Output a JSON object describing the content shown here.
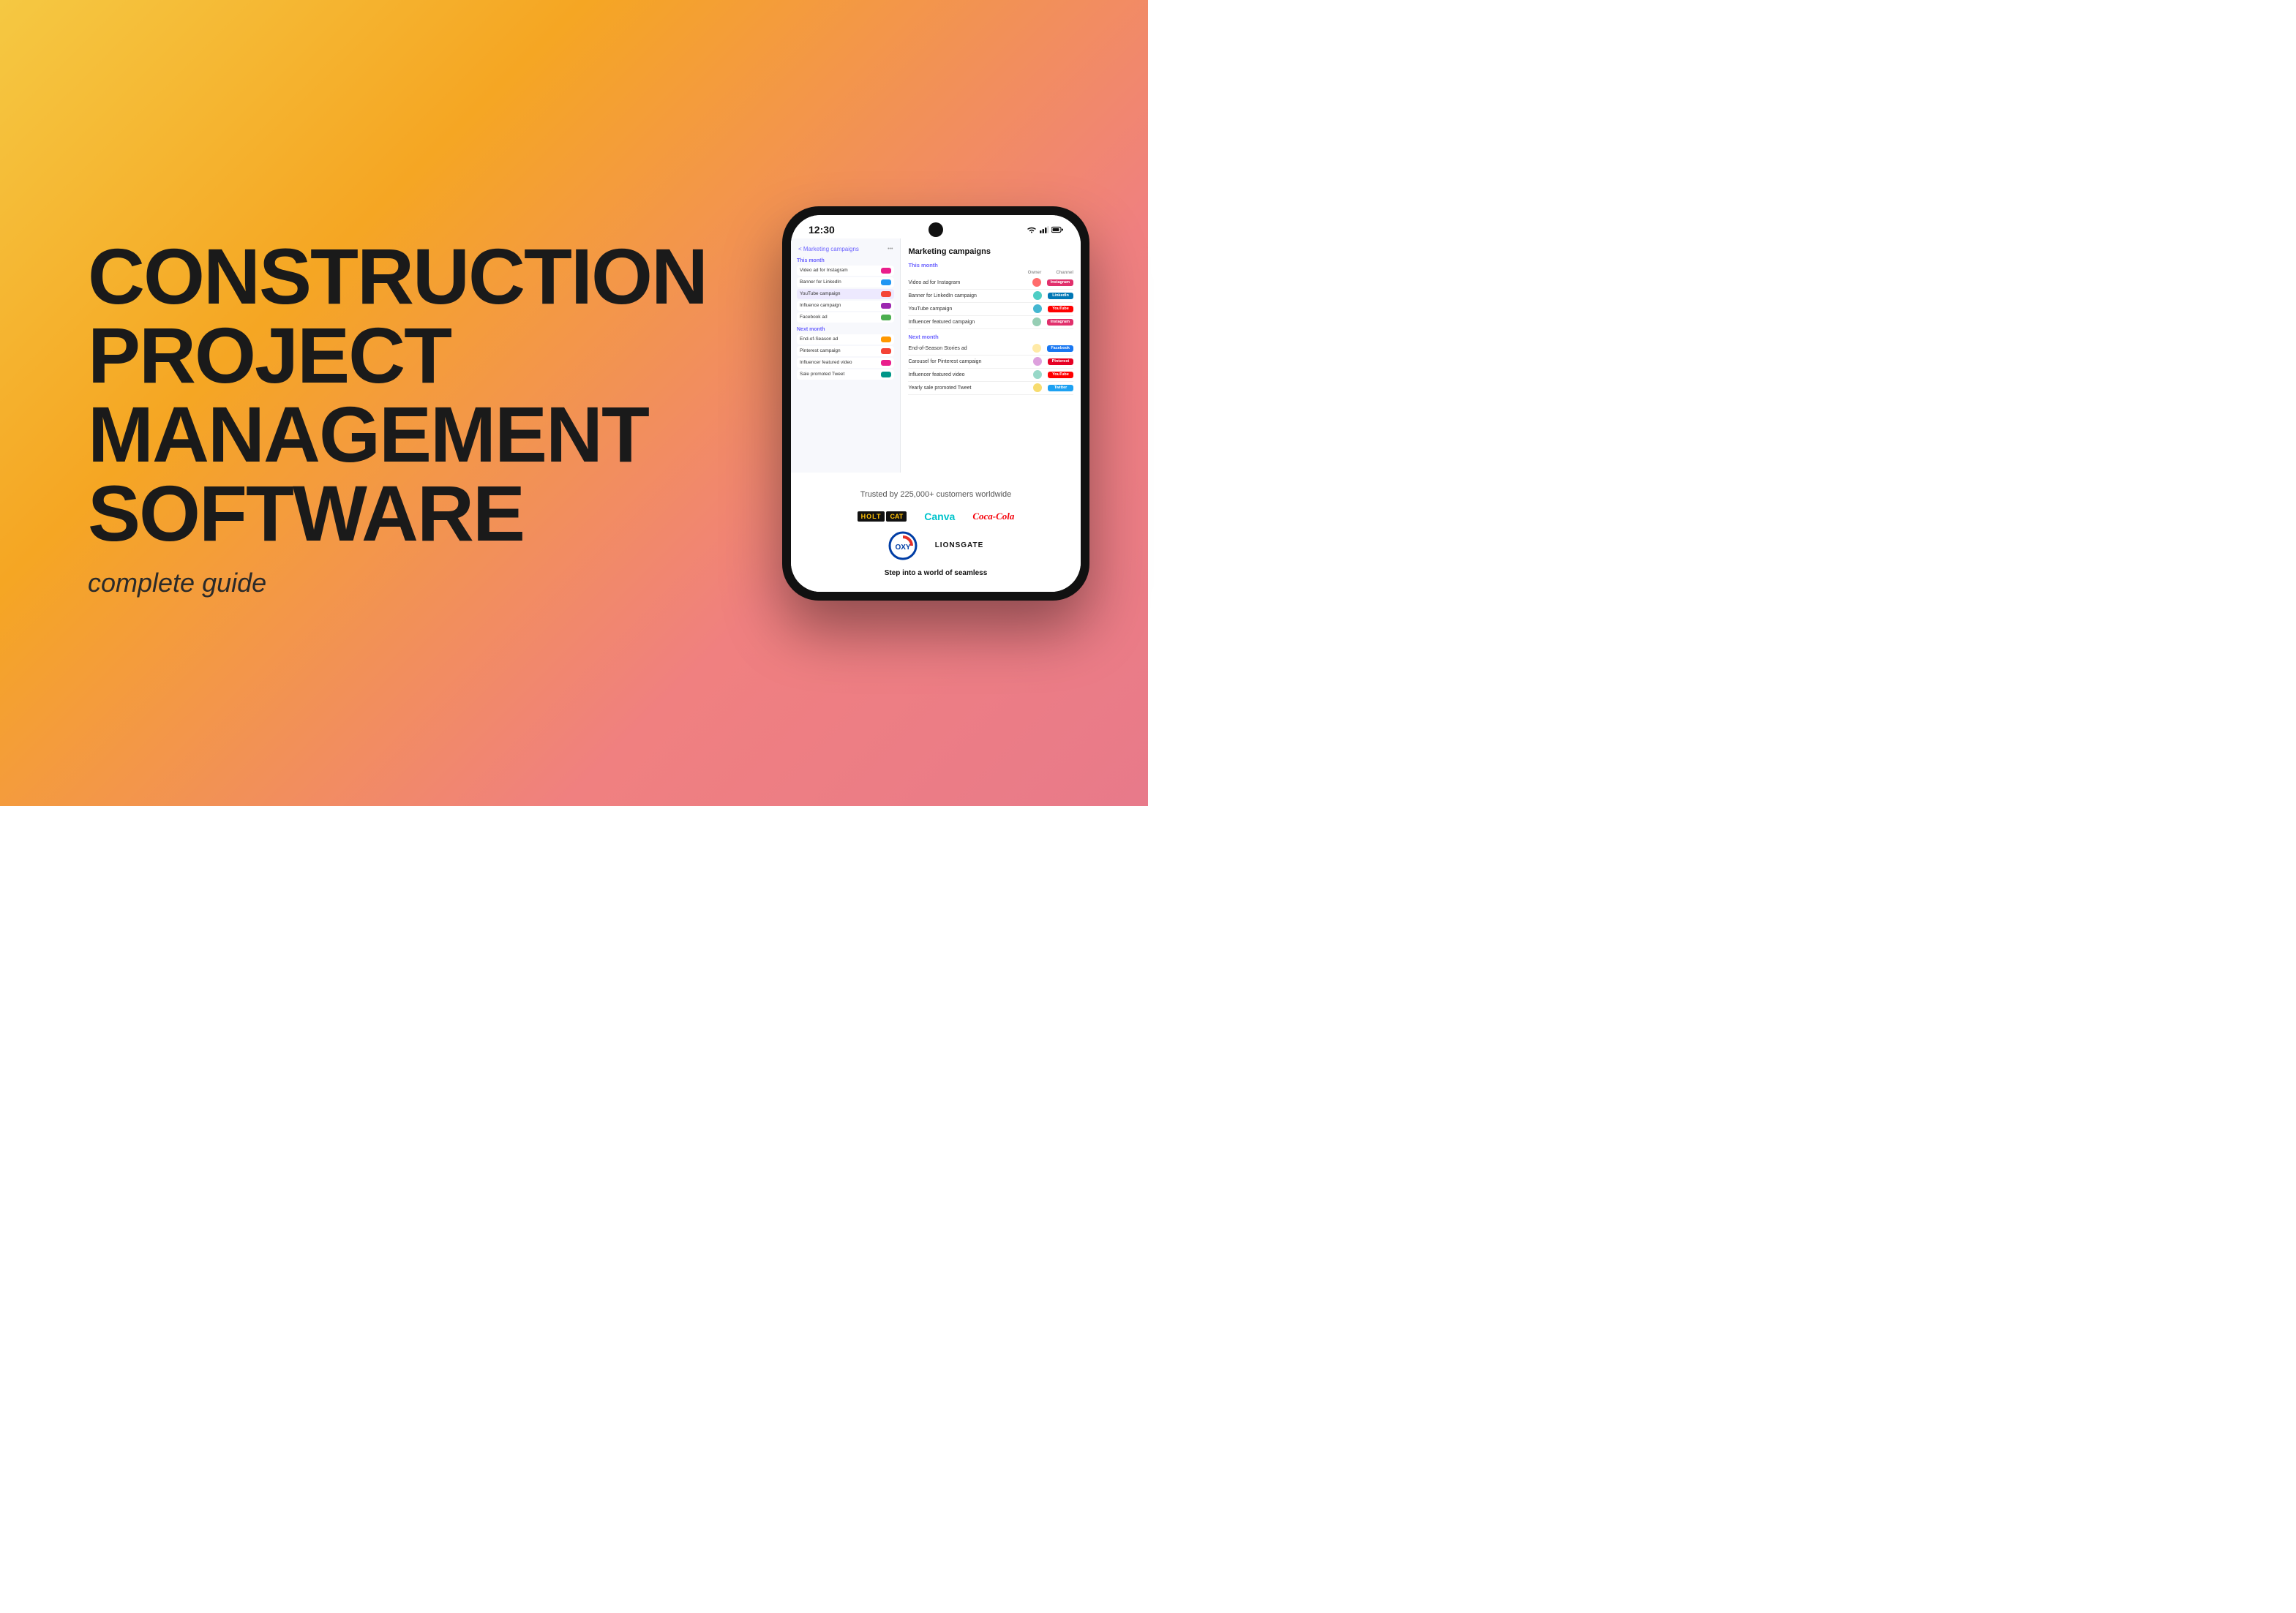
{
  "background": {
    "gradient_start": "#F5C842",
    "gradient_end": "#E87A8A"
  },
  "title": {
    "line1": "CONSTRUCTION",
    "line2": "PROJECT",
    "line3": "MANAGEMENT",
    "line4": "SOFTWARE",
    "subtitle": "complete guide"
  },
  "phone": {
    "status_time": "12:30",
    "status_icons": "signal wifi battery",
    "app": {
      "header": "Marketing campaigns",
      "back_label": "< Marketing campaigns",
      "this_month_label": "This month",
      "next_month_label": "Next month",
      "list_items_this_month": [
        {
          "text": "Video ad for Instagram",
          "dot_color": "dot-pink"
        },
        {
          "text": "Banner for LinkedIn",
          "dot_color": "dot-blue"
        },
        {
          "text": "YouTube campaign",
          "dot_color": "dot-red"
        },
        {
          "text": "Influence campaign",
          "dot_color": "dot-purple"
        },
        {
          "text": "Facebook ad",
          "dot_color": "dot-green"
        }
      ],
      "list_items_next_month": [
        {
          "text": "End-of-Season ad",
          "dot_color": "dot-orange"
        },
        {
          "text": "Pinterest campaign",
          "dot_color": "dot-red"
        },
        {
          "text": "Influencer featured video",
          "dot_color": "dot-pink"
        },
        {
          "text": "Sale promoted Tweet",
          "dot_color": "dot-teal"
        }
      ],
      "detail_title": "Marketing campaigns",
      "detail_this_month_label": "This month",
      "detail_next_month_label": "Next month",
      "owner_col": "Owner",
      "channel_col": "Channel",
      "detail_rows_this_month": [
        {
          "text": "Video ad for Instagram",
          "avatar": "av1",
          "channel": "Instagram",
          "badge": "badge-instagram"
        },
        {
          "text": "Banner for LinkedIn campaign",
          "avatar": "av2",
          "channel": "LinkedIn",
          "badge": "badge-linkedin"
        },
        {
          "text": "YouTube campaign",
          "avatar": "av3",
          "channel": "YouTube",
          "badge": "badge-youtube"
        },
        {
          "text": "Influencer featured campaign",
          "avatar": "av4",
          "channel": "Instagram",
          "badge": "badge-instagram"
        }
      ],
      "detail_rows_next_month": [
        {
          "text": "End-of-Season Stories ad",
          "avatar": "av5",
          "channel": "Facebook",
          "badge": "badge-facebook"
        },
        {
          "text": "Carousel for Pinterest campaign",
          "avatar": "av6",
          "channel": "Pinterest",
          "badge": "badge-pinterest"
        },
        {
          "text": "Influencer featured video",
          "avatar": "av7",
          "channel": "YouTube",
          "badge": "badge-youtube"
        },
        {
          "text": "Yearly sale promoted Tweet",
          "avatar": "av8",
          "channel": "Twitter",
          "badge": "badge-twitter"
        }
      ]
    },
    "trusted_title": "Trusted by 225,000+ customers worldwide",
    "logos": {
      "holt": "HOLT",
      "cat": "CAT",
      "canva": "Canva",
      "cocacola": "Coca-Cola",
      "oxy": "OXY",
      "lionsgate": "LIONSGATE"
    },
    "step_text": "Step into a world of seamless"
  }
}
